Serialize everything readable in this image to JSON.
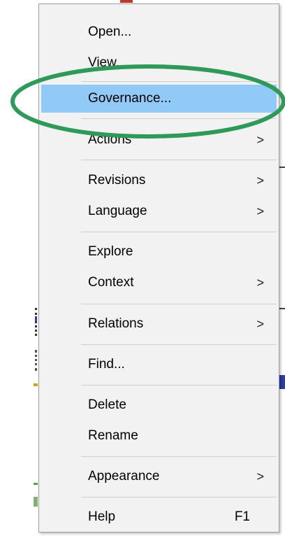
{
  "menu": {
    "items": [
      {
        "label": "Open...",
        "submenu": false
      },
      {
        "label": "View...",
        "submenu": false
      },
      {
        "label": "Governance...",
        "submenu": false,
        "highlighted": true
      },
      {
        "label": "Actions",
        "submenu": true
      },
      {
        "label": "Revisions",
        "submenu": true
      },
      {
        "label": "Language",
        "submenu": true
      },
      {
        "label": "Explore",
        "submenu": false
      },
      {
        "label": "Context",
        "submenu": true
      },
      {
        "label": "Relations",
        "submenu": true
      },
      {
        "label": "Find...",
        "submenu": false
      },
      {
        "label": "Delete",
        "submenu": false
      },
      {
        "label": "Rename",
        "submenu": false
      },
      {
        "label": "Appearance",
        "submenu": true
      },
      {
        "label": "Help",
        "submenu": false,
        "shortcut": "F1"
      }
    ],
    "arrow_glyph": ">"
  },
  "colors": {
    "highlight": "#91c9f7",
    "annotation_ellipse": "#2e9a5a",
    "menu_background": "#f2f2f2"
  }
}
